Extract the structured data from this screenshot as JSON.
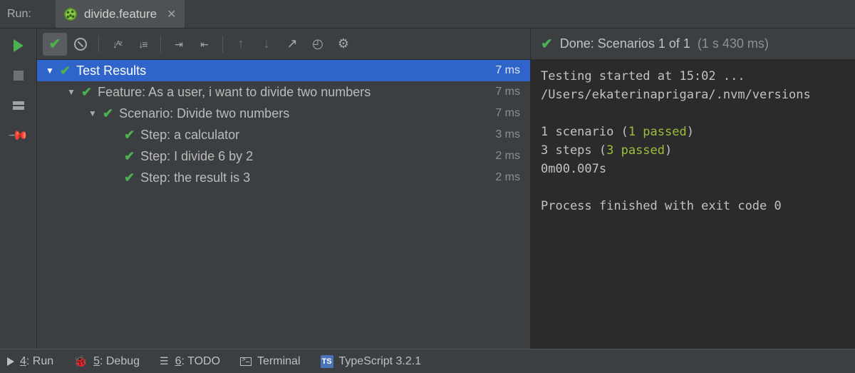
{
  "header": {
    "run_label": "Run:",
    "tab_name": "divide.feature"
  },
  "status": {
    "text": "Done: Scenarios 1 of 1",
    "timing": "(1 s 430 ms)"
  },
  "tree": [
    {
      "depth": 0,
      "disclose": true,
      "label": "Test Results",
      "time": "7 ms",
      "selected": true
    },
    {
      "depth": 1,
      "disclose": true,
      "label": "Feature: As a user, i want to divide two numbers",
      "time": "7 ms"
    },
    {
      "depth": 2,
      "disclose": true,
      "label": "Scenario: Divide two numbers",
      "time": "7 ms"
    },
    {
      "depth": 3,
      "disclose": false,
      "label": "Step: a calculator",
      "time": "3 ms"
    },
    {
      "depth": 3,
      "disclose": false,
      "label": "Step: I divide 6 by 2",
      "time": "2 ms"
    },
    {
      "depth": 3,
      "disclose": false,
      "label": "Step: the result is 3",
      "time": "2 ms"
    }
  ],
  "console": {
    "line1": "Testing started at 15:02 ...",
    "line2": "/Users/ekaterinaprigara/.nvm/versions",
    "scenario_prefix": "1 scenario (",
    "scenario_pass": "1 passed",
    "steps_prefix": "3 steps (",
    "steps_pass": "3 passed",
    "close_paren": ")",
    "duration": "0m00.007s",
    "exit": "Process finished with exit code 0"
  },
  "bottom": {
    "run": {
      "key": "4",
      "label": ": Run"
    },
    "debug": {
      "key": "5",
      "label": ": Debug"
    },
    "todo": {
      "key": "6",
      "label": ": TODO"
    },
    "terminal": "Terminal",
    "typescript": "TypeScript 3.2.1"
  }
}
